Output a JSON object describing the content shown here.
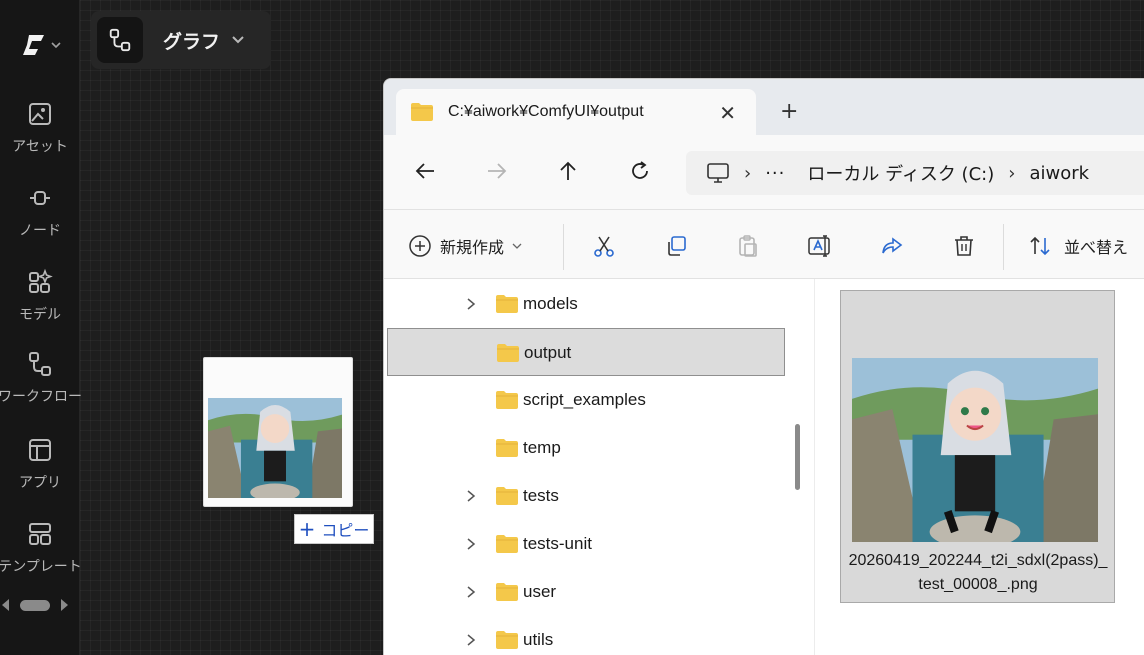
{
  "sidebar": {
    "items": [
      {
        "label": "アセット",
        "icon": "asset-image-icon"
      },
      {
        "label": "ノード",
        "icon": "node-icon"
      },
      {
        "label": "モデル",
        "icon": "model-grid-icon"
      },
      {
        "label": "ワークフロー",
        "icon": "workflow-icon"
      },
      {
        "label": "アプリ",
        "icon": "app-layout-icon"
      },
      {
        "label": "テンプレート",
        "icon": "template-icon"
      }
    ]
  },
  "graph": {
    "label": "グラフ"
  },
  "drag": {
    "copy_label": "コピー"
  },
  "explorer": {
    "tab_title": "C:¥aiwork¥ComfyUI¥output",
    "address": {
      "drive": "ローカル ディスク (C:)",
      "folder": "aiwork"
    },
    "toolbar": {
      "new_label": "新規作成",
      "sort_label": "並べ替え"
    },
    "tree": [
      {
        "name": "models",
        "expandable": true,
        "selected": false
      },
      {
        "name": "output",
        "expandable": false,
        "selected": true
      },
      {
        "name": "script_examples",
        "expandable": false,
        "selected": false
      },
      {
        "name": "temp",
        "expandable": false,
        "selected": false
      },
      {
        "name": "tests",
        "expandable": true,
        "selected": false
      },
      {
        "name": "tests-unit",
        "expandable": true,
        "selected": false
      },
      {
        "name": "user",
        "expandable": true,
        "selected": false
      },
      {
        "name": "utils",
        "expandable": true,
        "selected": false
      }
    ],
    "file": {
      "name": "20260419_202244_t2i_sdxl(2pass)_test_00008_.png"
    }
  },
  "colors": {
    "accent": "#1f4fbf",
    "folder": "#f4c84a",
    "canvas": "#1e1e1e"
  }
}
